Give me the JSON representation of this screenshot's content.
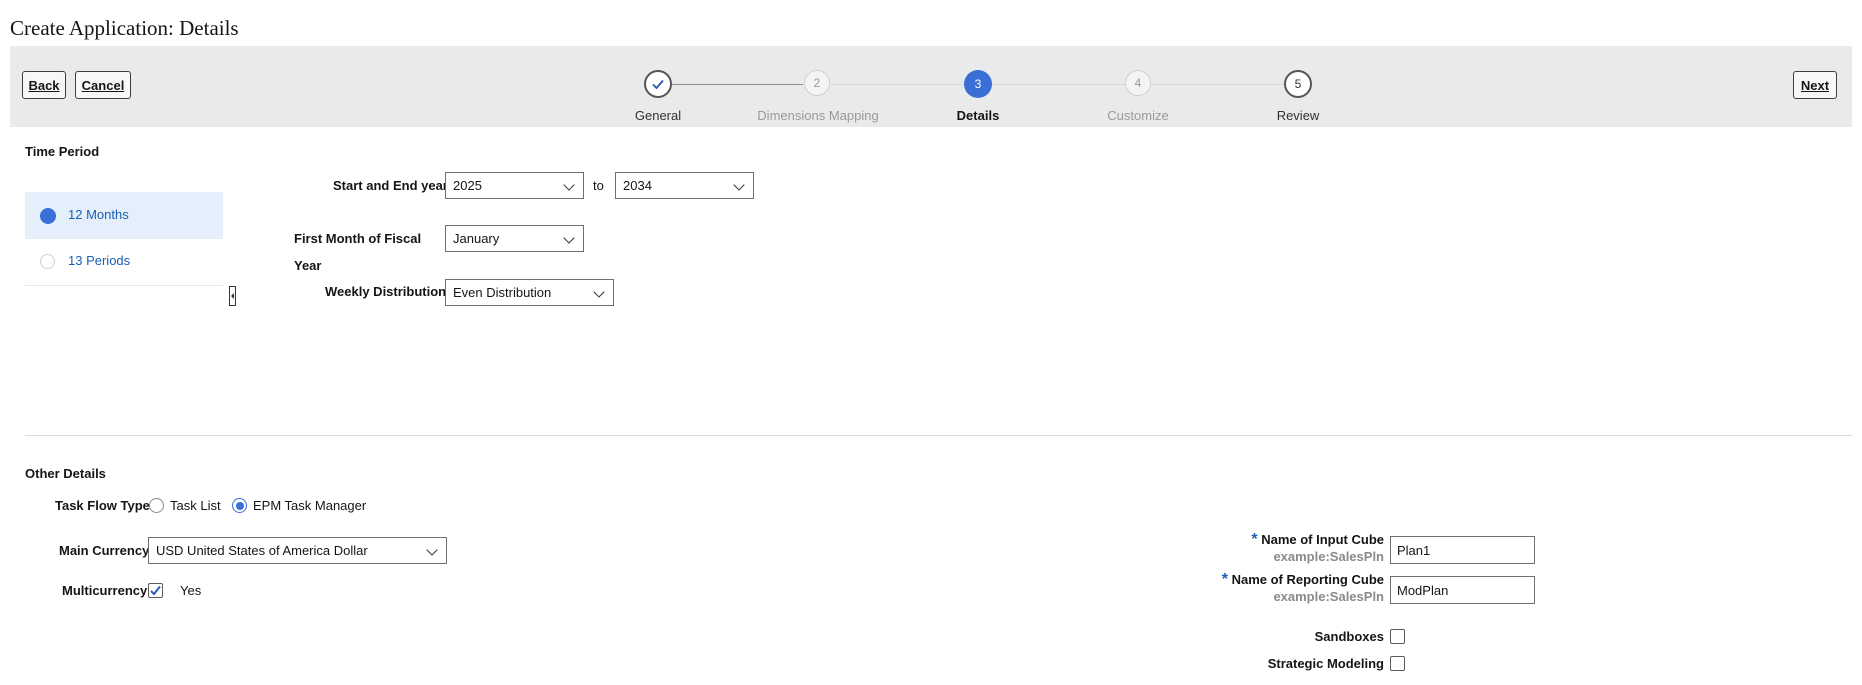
{
  "page": {
    "title": "Create Application: Details"
  },
  "train": {
    "back_label": "Back",
    "cancel_label": "Cancel",
    "next_label": "Next",
    "steps": [
      {
        "label": "General",
        "number": "",
        "state": "done"
      },
      {
        "label": "Dimensions Mapping",
        "number": "2",
        "state": "disabled"
      },
      {
        "label": "Details",
        "number": "3",
        "state": "current"
      },
      {
        "label": "Customize",
        "number": "4",
        "state": "disabled"
      },
      {
        "label": "Review",
        "number": "5",
        "state": "enabled"
      }
    ]
  },
  "time_period": {
    "title": "Time Period",
    "options": [
      {
        "label": "12 Months",
        "selected": true
      },
      {
        "label": "13 Periods",
        "selected": false
      }
    ],
    "start_end_label": "Start and End year",
    "start_year": "2025",
    "to_label": "to",
    "end_year": "2034",
    "fiscal_label_line1": "First Month of Fiscal",
    "fiscal_label_line2": "Year",
    "fiscal_month": "January",
    "weekly_label": "Weekly Distribution",
    "weekly_value": "Even Distribution"
  },
  "other_details": {
    "title": "Other Details",
    "task_flow_label": "Task Flow Type",
    "task_flow_options": [
      {
        "label": "Task List",
        "selected": false
      },
      {
        "label": "EPM Task Manager",
        "selected": true
      }
    ],
    "main_currency_label": "Main Currency",
    "main_currency_value": "USD United States of America Dollar",
    "multicurrency_label": "Multicurrency",
    "multicurrency_yes": "Yes",
    "multicurrency_checked": true,
    "required_mark": "*",
    "input_cube_label": "Name of Input Cube",
    "input_cube_hint": "example:SalesPln",
    "input_cube_value": "Plan1",
    "reporting_cube_label": "Name of Reporting Cube",
    "reporting_cube_hint": "example:SalesPln",
    "reporting_cube_value": "ModPlan",
    "sandboxes_label": "Sandboxes",
    "strategic_label": "Strategic Modeling"
  },
  "colors": {
    "accent": "#3a6fd6",
    "train_bg": "#e9eaeb",
    "selected_bg": "#e4effb",
    "link": "#1a5fb4"
  }
}
